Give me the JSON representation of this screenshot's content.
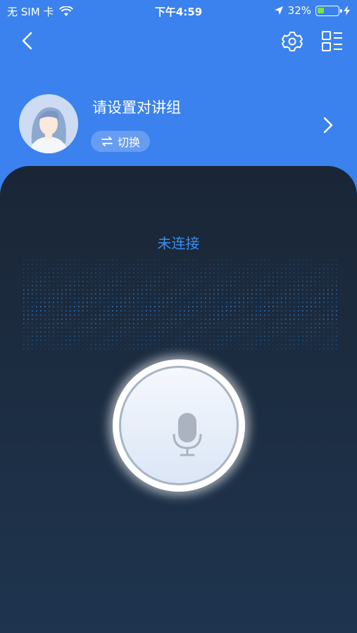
{
  "status_bar": {
    "carrier": "无 SIM 卡",
    "time": "下午4:59",
    "battery_percent": "32%",
    "battery_level": 0.32
  },
  "profile": {
    "group_title": "请设置对讲组",
    "switch_label": "切换"
  },
  "talk": {
    "connection_status": "未连接"
  },
  "colors": {
    "header_blue": "#3b82ee",
    "status_blue": "#3a8ff0",
    "battery_green": "#7ee24a"
  }
}
